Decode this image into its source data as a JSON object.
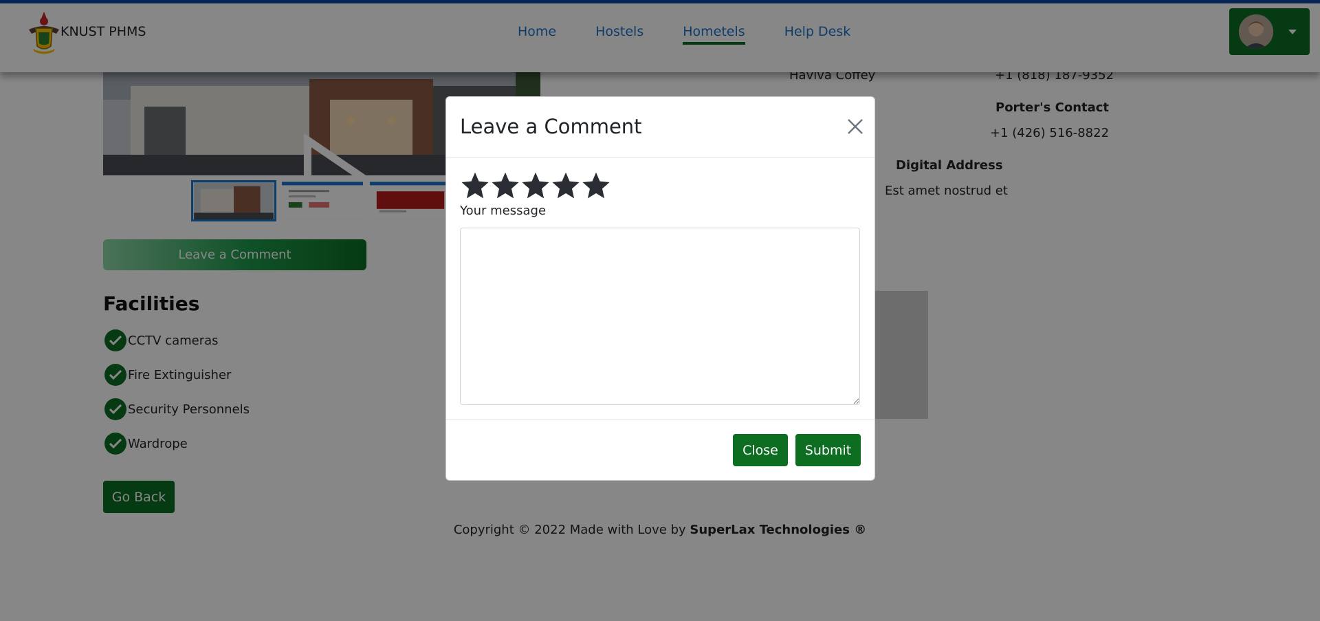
{
  "navbar": {
    "brand": "KNUST PHMS",
    "links": [
      "Home",
      "Hostels",
      "Hometels",
      "Help Desk"
    ],
    "active_link": "Hometels"
  },
  "contacts": {
    "manager_name": "Haviva Coffey",
    "manager_phone": "+1 (818) 187-9352",
    "porter_label": "Porter's Contact",
    "porter_phone": "+1 (426) 516-8822",
    "digital_address_label": "Digital Address",
    "digital_address_value": "Est amet nostrud et"
  },
  "page": {
    "leave_comment_label": "Leave a Comment",
    "facilities_title": "Facilities",
    "facilities": [
      "CCTV cameras",
      "Fire Extinguisher",
      "Security Personnels",
      "Wardrope"
    ],
    "go_back_label": "Go Back"
  },
  "footer": {
    "prefix": "Copyright © 2022 Made with Love by ",
    "company": "SuperLax Technologies ®"
  },
  "modal": {
    "title": "Leave a Comment",
    "rating_stars": 5,
    "message_label": "Your message",
    "message_value": "",
    "close_label": "Close",
    "submit_label": "Submit"
  },
  "colors": {
    "brand_green": "#0d6e22",
    "nav_blue": "#1a73c8",
    "top_bar_blue": "#0d47a1"
  },
  "icons": {
    "logo": "knust-crest-icon",
    "avatar": "user-avatar",
    "check": "check-circle-icon",
    "star": "star-icon",
    "close": "close-icon",
    "play": "play-icon"
  }
}
